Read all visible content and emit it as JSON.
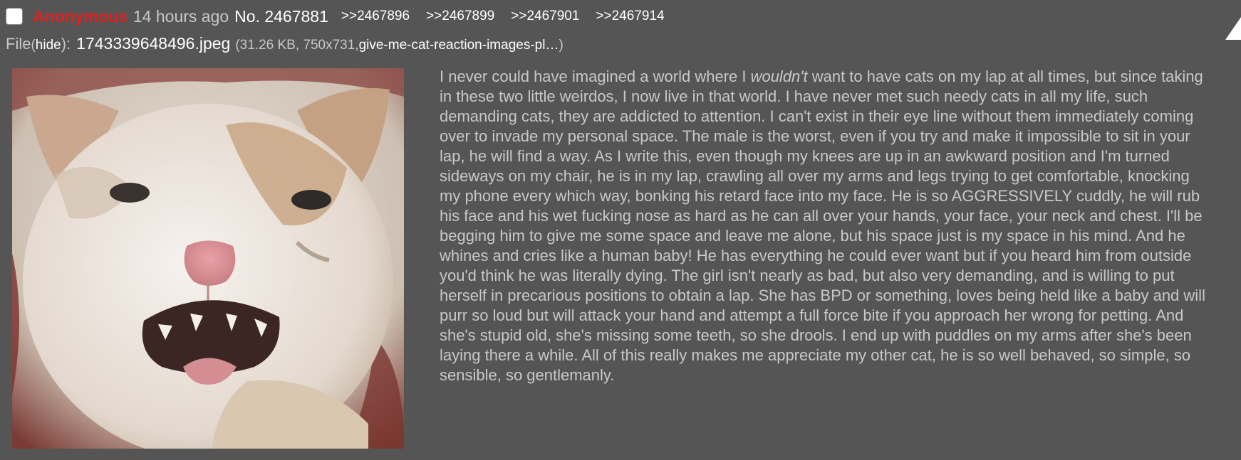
{
  "post": {
    "name": "Anonymous",
    "time": "14 hours ago",
    "number": "No. 2467881",
    "replies": [
      ">>2467896",
      ">>2467899",
      ">>2467901",
      ">>2467914"
    ]
  },
  "file": {
    "label": "File",
    "hide_open": "(",
    "hide_label": "hide",
    "hide_close": "):",
    "name": "1743339648496.jpeg",
    "meta_open": "(31.26 KB, 750x731, ",
    "original_name": "give-me-cat-reaction-images-pl…",
    "meta_close": ")"
  },
  "body": {
    "prefix": "I never could have imagined a world where I ",
    "emphasis": "wouldn't",
    "suffix": " want to have cats on my lap at all times, but since taking in these two little weirdos, I now live in that world. I have never met such needy cats in all my life, such demanding cats, they are addicted to attention. I can't exist in their eye line without them immediately coming over to invade my personal space. The male is the worst, even if you try and make it impossible to sit in your lap, he will find a way. As I write this, even though my knees are up in an awkward position and I'm turned sideways on my chair, he is in my lap, crawling all over my arms and legs trying to get comfortable, knocking my phone every which way, bonking his retard face into my face. He is so AGGRESSIVELY cuddly, he will rub his face and his wet fucking nose as hard as he can all over your hands, your face, your neck and chest. I'll be begging him to give me some space and leave me alone, but his space just is my space in his mind. And he whines and cries like a human baby! He has everything he could ever want but if you heard him from outside you'd think he was literally dying. The girl isn't nearly as bad, but also very demanding, and is willing to put herself in precarious positions to obtain a lap. She has BPD or something, loves being held like a baby and will purr so loud but will attack your hand and attempt a full force bite if you approach her wrong for petting. And she's stupid old, she's missing some teeth, so she drools. I end up with puddles on my arms after she's been laying there a while. All of this really makes me appreciate my other cat, he is so well behaved, so simple, so sensible, so gentlemanly."
  },
  "colors": {
    "background": "#555555",
    "name": "#e02020",
    "text": "#c8c8c8",
    "link": "#ffffff"
  },
  "icons": {
    "select": "checkbox-icon",
    "corner": "triangle-up-icon",
    "image": "cat-thumbnail-image"
  }
}
